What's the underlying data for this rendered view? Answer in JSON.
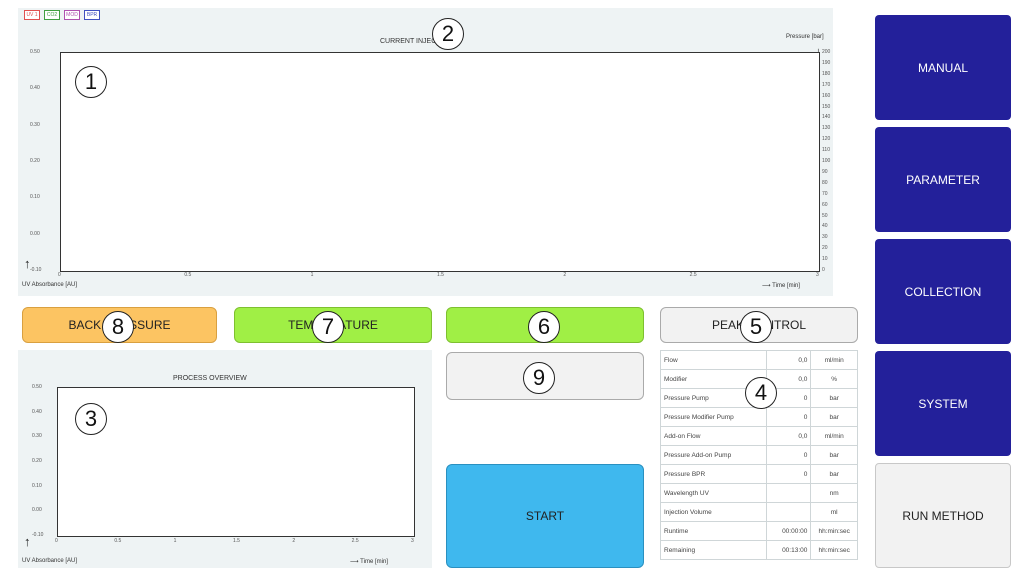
{
  "legend": [
    {
      "label": "UV 1",
      "color": "#e05050"
    },
    {
      "label": "CO2",
      "color": "#40a040"
    },
    {
      "label": "MOD",
      "color": "#b050b0"
    },
    {
      "label": "BPR",
      "color": "#4050c0"
    }
  ],
  "current_chart": {
    "title": "CURRENT INJECTION",
    "ylabel_left": "UV Absorbance [AU]",
    "ylabel_right": "Pressure [bar]",
    "xlabel": "Time [min]",
    "y_ticks": [
      "0.50",
      "0.40",
      "0.30",
      "0.20",
      "0.10",
      "0.00",
      "-0.10"
    ],
    "x_ticks": [
      "0",
      "0.5",
      "1",
      "1.5",
      "2",
      "2.5",
      "3"
    ],
    "right_ticks": [
      "200",
      "190",
      "180",
      "170",
      "160",
      "150",
      "140",
      "130",
      "120",
      "110",
      "100",
      "90",
      "80",
      "70",
      "60",
      "50",
      "40",
      "30",
      "20",
      "10",
      "0"
    ]
  },
  "process_chart": {
    "title": "PROCESS OVERVIEW",
    "ylabel": "UV Absorbance [AU]",
    "xlabel": "Time [min]",
    "y_ticks": [
      "0.50",
      "0.40",
      "0.30",
      "0.20",
      "0.10",
      "0.00",
      "-0.10"
    ],
    "x_ticks": [
      "0",
      "0.5",
      "1",
      "1.5",
      "2",
      "2.5",
      "3"
    ]
  },
  "buttons": {
    "back_pressure": "BACK PRESSURE",
    "temperature": "TEMPERATURE",
    "green_blank": "",
    "peak_control": "PEAK CONTROL",
    "blank_grey": "",
    "start": "START"
  },
  "nav": {
    "manual": "MANUAL",
    "parameter": "PARAMETER",
    "collection": "COLLECTION",
    "system": "SYSTEM",
    "run_method": "RUN METHOD"
  },
  "status_table": [
    {
      "name": "Flow",
      "value": "0,0",
      "unit": "ml/min"
    },
    {
      "name": "Modifier",
      "value": "0,0",
      "unit": "%"
    },
    {
      "name": "Pressure Pump",
      "value": "0",
      "unit": "bar"
    },
    {
      "name": "Pressure Modifier Pump",
      "value": "0",
      "unit": "bar"
    },
    {
      "name": "Add-on Flow",
      "value": "0,0",
      "unit": "ml/min"
    },
    {
      "name": "Pressure Add-on Pump",
      "value": "0",
      "unit": "bar"
    },
    {
      "name": "Pressure BPR",
      "value": "0",
      "unit": "bar"
    },
    {
      "name": "Wavelength UV",
      "value": "",
      "unit": "nm"
    },
    {
      "name": "Injection Volume",
      "value": "",
      "unit": "ml"
    },
    {
      "name": "Runtime",
      "value": "00:00:00",
      "unit": "hh:min:sec"
    },
    {
      "name": "Remaining",
      "value": "00:13:00",
      "unit": "hh:min:sec"
    }
  ],
  "callouts": [
    "1",
    "2",
    "3",
    "4",
    "5",
    "6",
    "7",
    "8",
    "9"
  ],
  "colors": {
    "orange": "#fcc462",
    "green": "#a0ef45",
    "start_blue": "#3fb8ee",
    "nav_blue": "#23209a"
  }
}
